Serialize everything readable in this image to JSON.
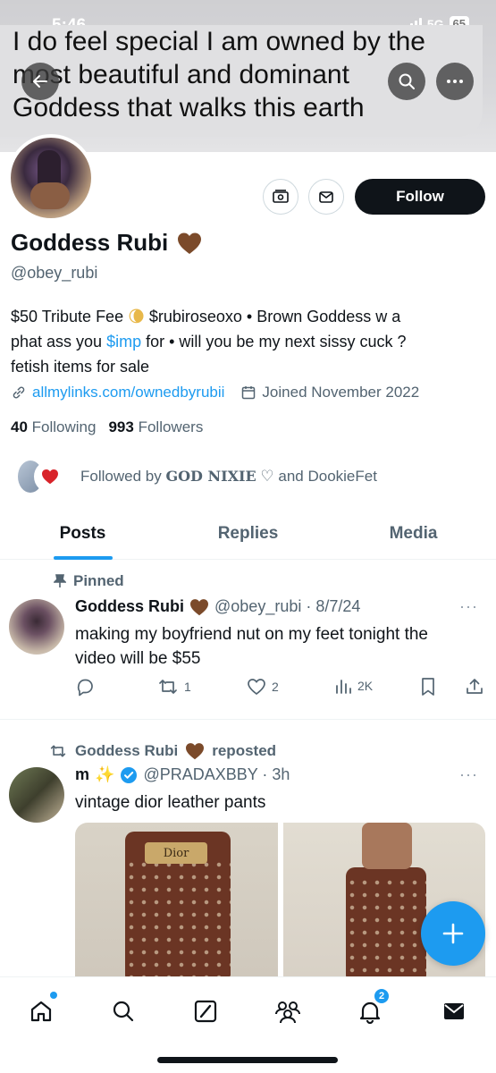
{
  "status_bar": {
    "time": "5:46",
    "network": "5G",
    "battery": "65"
  },
  "caption": {
    "lines": [
      "I do feel special I am owned by the",
      "most beautiful and dominant",
      "Goddess that walks this earth"
    ]
  },
  "profile": {
    "name": "Goddess Rubi",
    "handle": "@obey_rubi",
    "follow_label": "Follow",
    "bio_lines": {
      "line1_a": "$50 Tribute Fee ",
      "line1_b": " $rubiroseoxo • Brown Goddess w a",
      "line2_a": "phat ass you ",
      "line2_link": "$imp",
      "line2_b": " for • will you be my next sissy cuck ?",
      "line3": "fetish items for sale"
    },
    "link": "allmylinks.com/ownedbyrubii",
    "joined": "Joined November 2022",
    "following_count": "40",
    "following_label": "Following",
    "followers_count": "993",
    "followers_label": "Followers",
    "followed_by_prefix": "Followed by ",
    "followed_by_name": "GOD NIXIE",
    "followed_by_suffix": " ♡ and DookieFet"
  },
  "tabs": [
    "Posts",
    "Replies",
    "Media"
  ],
  "posts": [
    {
      "pinned_label": "Pinned",
      "author": "Goddess Rubi",
      "handle_date": "@obey_rubi · 8/7/24",
      "text_line1": "making my boyfriend nut on my feet tonight the",
      "text_line2": "video will be $55",
      "replies": "",
      "reposts": "1",
      "likes": "2",
      "views": "2K"
    },
    {
      "repost_label": "Goddess Rubi",
      "repost_suffix": "reposted",
      "author": "m",
      "handle_date": "@PRADAXBBY · 3h",
      "text": "vintage dior leather pants",
      "image_label": "Dior"
    }
  ],
  "nav": {
    "notifications_badge": "2"
  },
  "colors": {
    "accent": "#1d9bf0",
    "text": "#0f1419",
    "muted": "#536471",
    "heart": "#7b4a2a"
  }
}
